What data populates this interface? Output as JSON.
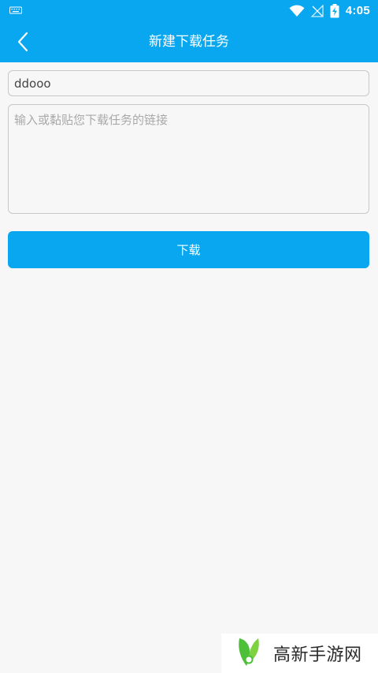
{
  "status_bar": {
    "time": "4:05",
    "icons": [
      "keyboard-icon",
      "wifi-icon",
      "no-signal-icon",
      "battery-charging-icon"
    ]
  },
  "header": {
    "title": "新建下载任务",
    "back_icon": "chevron-left-icon"
  },
  "form": {
    "name_value": "ddooo",
    "link_placeholder": "输入或黏贴您下载任务的链接",
    "link_value": "",
    "download_label": "下载"
  },
  "watermark": {
    "text": "高新手游网"
  },
  "colors": {
    "primary": "#08a7f0",
    "background": "#f7f7f7",
    "border": "#c8c8c8",
    "placeholder": "#a9a9a9"
  }
}
